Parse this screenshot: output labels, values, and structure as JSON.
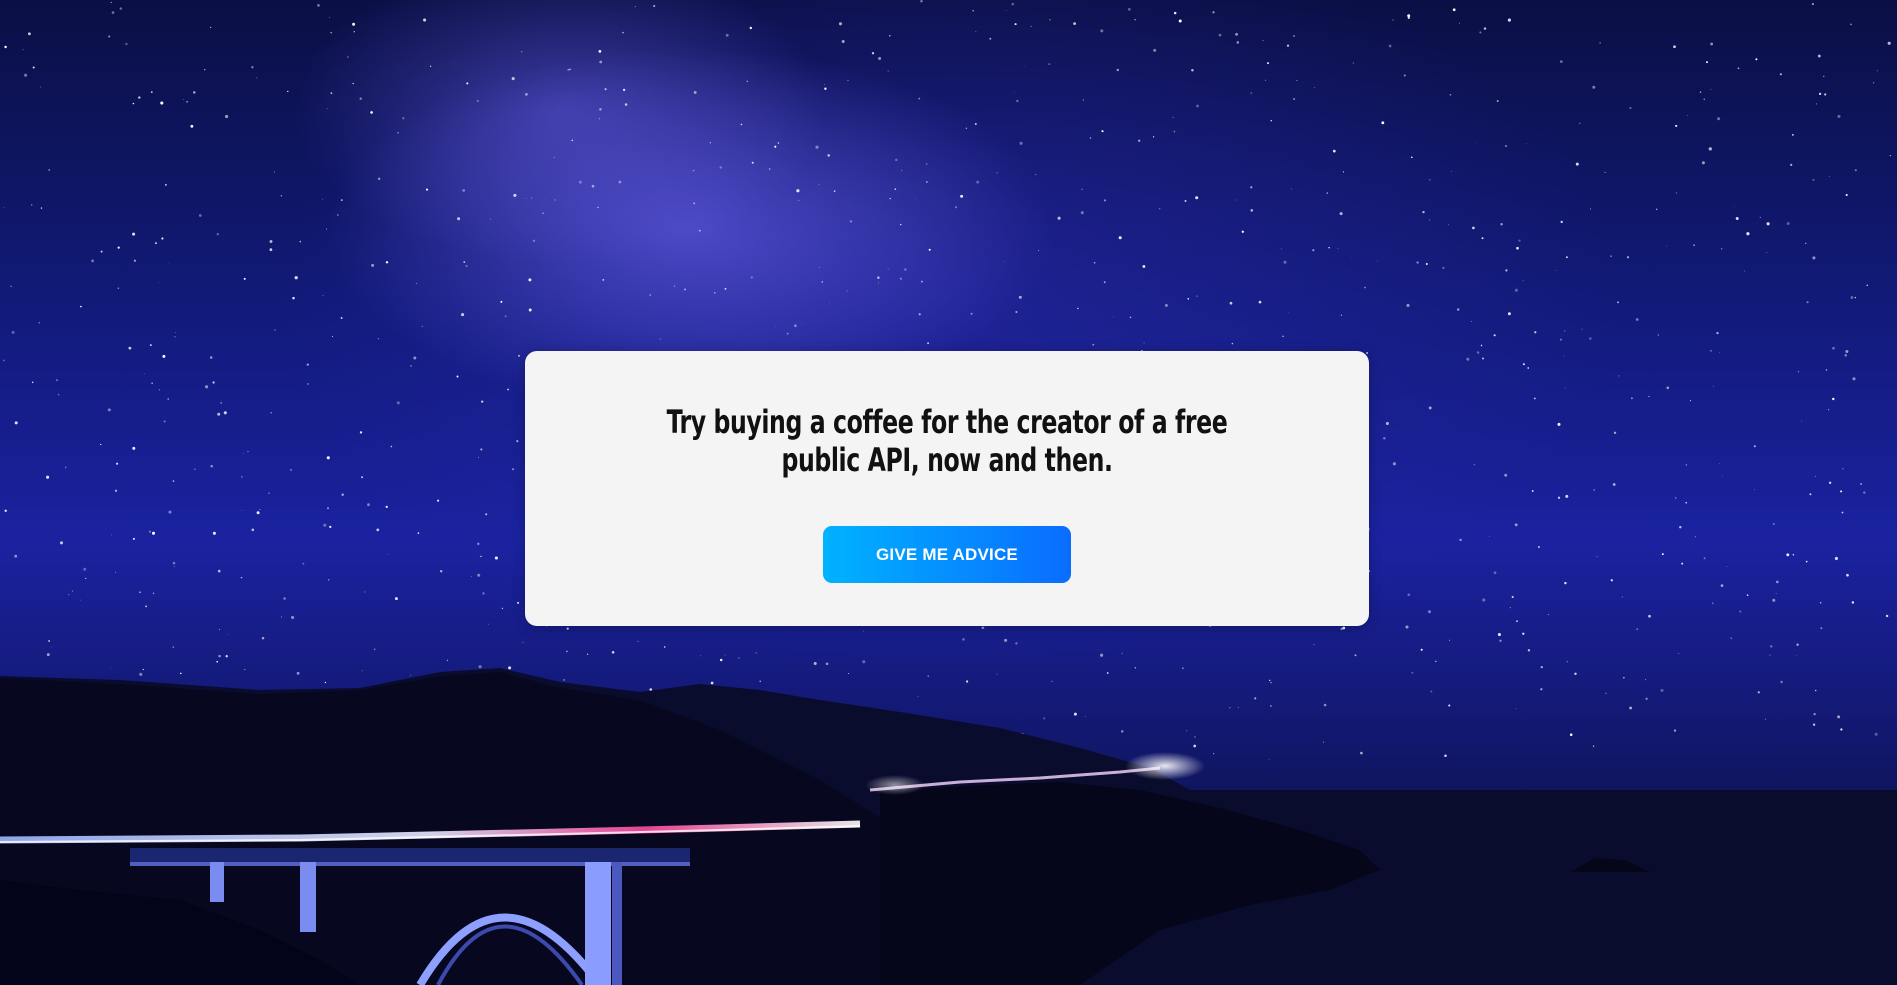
{
  "advice": {
    "text": "Try buying a coffee for the creator of a free public API, now and then."
  },
  "button": {
    "label": "GIVE ME ADVICE"
  },
  "background": {
    "description_icon": "night-sky-bridge-image"
  },
  "colors": {
    "card_bg": "#f4f4f4",
    "button_start": "#00b3ff",
    "button_end": "#0a6cff",
    "text": "#111111"
  }
}
